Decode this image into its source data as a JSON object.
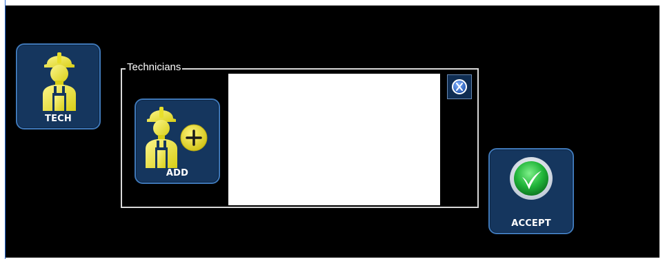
{
  "buttons": {
    "tech_label": "TECH",
    "add_label": "ADD",
    "accept_label": "ACCEPT"
  },
  "technicians": {
    "title": "Technicians",
    "items": []
  },
  "icons": {
    "tech": "technician-worker-icon",
    "add": "add-technician-plus-icon",
    "accept": "green-checkmark-icon",
    "close": "close-x-icon"
  },
  "colors": {
    "background": "#000000",
    "tile": "#15365e",
    "tile_border": "#3f78b8",
    "worker": "#f2ea3a",
    "accept_green": "#21b53a"
  }
}
